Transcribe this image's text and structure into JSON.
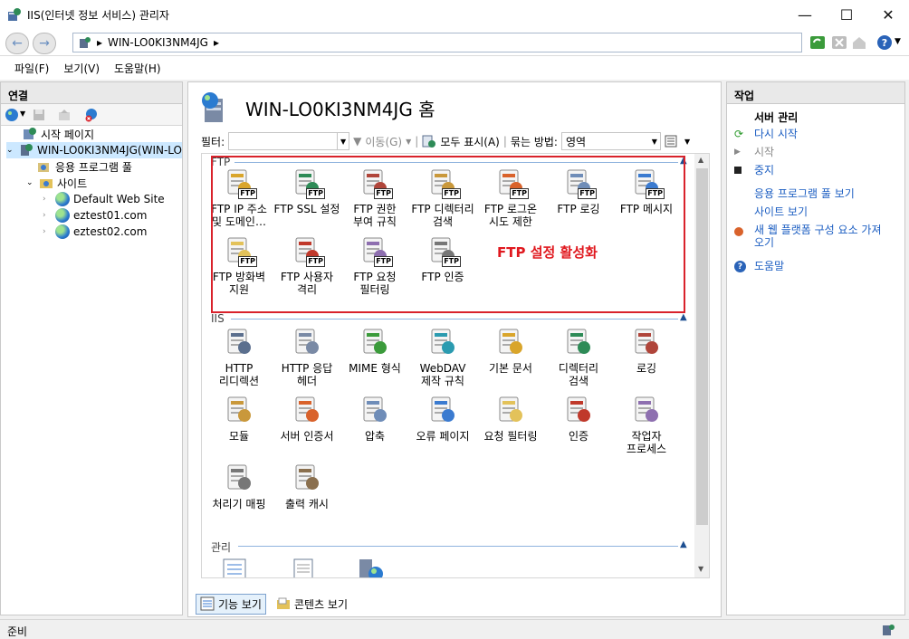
{
  "window": {
    "title": "IIS(인터넷 정보 서비스) 관리자"
  },
  "address": {
    "path": "WIN-LO0KI3NM4JG",
    "sep": "▸"
  },
  "menu": [
    "파일(F)",
    "보기(V)",
    "도움말(H)"
  ],
  "connections": {
    "title": "연결",
    "tree": [
      {
        "label": "시작 페이지",
        "icon": "start-page-icon"
      },
      {
        "label": "WIN-LO0KI3NM4JG(WIN-LO",
        "icon": "server-icon",
        "expander": "v"
      },
      {
        "label": "응용 프로그램 풀",
        "icon": "app-pool-icon"
      },
      {
        "label": "사이트",
        "icon": "sites-folder-icon",
        "expander": "v"
      },
      {
        "label": "Default Web Site",
        "icon": "globe-icon",
        "expander": ">"
      },
      {
        "label": "eztest01.com",
        "icon": "globe-icon",
        "expander": ">"
      },
      {
        "label": "eztest02.com",
        "icon": "globe-icon",
        "expander": ">"
      }
    ]
  },
  "center": {
    "title": "WIN-LO0KI3NM4JG 홈",
    "filter_label": "필터:",
    "go_label": "이동(G)",
    "show_all_label": "모두 표시(A)",
    "group_label": "묶는 방법:",
    "group_value": "영역",
    "sections": {
      "ftp": "FTP",
      "iis": "IIS",
      "manage": "관리"
    },
    "ftp_items": [
      {
        "label": "FTP IP 주소\n및 도메인…",
        "icon": "ftp-ip-icon"
      },
      {
        "label": "FTP SSL 설정",
        "icon": "ftp-ssl-icon"
      },
      {
        "label": "FTP 권한\n부여 규칙",
        "icon": "ftp-auth-rules-icon"
      },
      {
        "label": "FTP 디렉터리\n검색",
        "icon": "ftp-dir-browse-icon"
      },
      {
        "label": "FTP 로그온\n시도 제한",
        "icon": "ftp-logon-limit-icon"
      },
      {
        "label": "FTP 로깅",
        "icon": "ftp-logging-icon"
      },
      {
        "label": "FTP 메시지",
        "icon": "ftp-message-icon"
      },
      {
        "label": "FTP 방화벽\n지원",
        "icon": "ftp-firewall-icon"
      },
      {
        "label": "FTP 사용자\n격리",
        "icon": "ftp-user-isolation-icon"
      },
      {
        "label": "FTP 요청\n필터링",
        "icon": "ftp-request-filter-icon"
      },
      {
        "label": "FTP 인증",
        "icon": "ftp-authentication-icon"
      }
    ],
    "note": "FTP 설정 활성화",
    "iis_items": [
      {
        "label": "HTTP\n리디렉션",
        "icon": "http-redirect-icon"
      },
      {
        "label": "HTTP 응답\n헤더",
        "icon": "http-headers-icon"
      },
      {
        "label": "MIME 형식",
        "icon": "mime-icon"
      },
      {
        "label": "WebDAV\n제작 규칙",
        "icon": "webdav-icon"
      },
      {
        "label": "기본 문서",
        "icon": "default-doc-icon"
      },
      {
        "label": "디렉터리\n검색",
        "icon": "dir-browse-icon"
      },
      {
        "label": "로깅",
        "icon": "logging-icon"
      },
      {
        "label": "모듈",
        "icon": "modules-icon"
      },
      {
        "label": "서버 인증서",
        "icon": "server-cert-icon"
      },
      {
        "label": "압축",
        "icon": "compression-icon"
      },
      {
        "label": "오류 페이지",
        "icon": "error-page-icon"
      },
      {
        "label": "요청 필터링",
        "icon": "request-filter-icon"
      },
      {
        "label": "인증",
        "icon": "authentication-icon"
      },
      {
        "label": "작업자\n프로세스",
        "icon": "worker-process-icon"
      },
      {
        "label": "처리기 매핑",
        "icon": "handler-mapping-icon"
      },
      {
        "label": "출력 캐시",
        "icon": "output-cache-icon"
      }
    ],
    "view_tabs": [
      "기능 보기",
      "콘텐츠 보기"
    ]
  },
  "actions": {
    "title": "작업",
    "group": "서버 관리",
    "items": [
      {
        "label": "다시 시작",
        "enabled": true,
        "icon": "restart-icon"
      },
      {
        "label": "시작",
        "enabled": false,
        "icon": "start-icon"
      },
      {
        "label": "중지",
        "enabled": true,
        "icon": "stop-icon"
      },
      {
        "label": "응용 프로그램 풀 보기",
        "enabled": true
      },
      {
        "label": "사이트 보기",
        "enabled": true
      },
      {
        "label": "새 웹 플랫폼 구성 요소 가져\n오기",
        "enabled": true,
        "icon": "web-platform-icon"
      },
      {
        "label": "도움말",
        "enabled": true,
        "icon": "help-icon"
      }
    ]
  },
  "status": {
    "text": "준비"
  }
}
